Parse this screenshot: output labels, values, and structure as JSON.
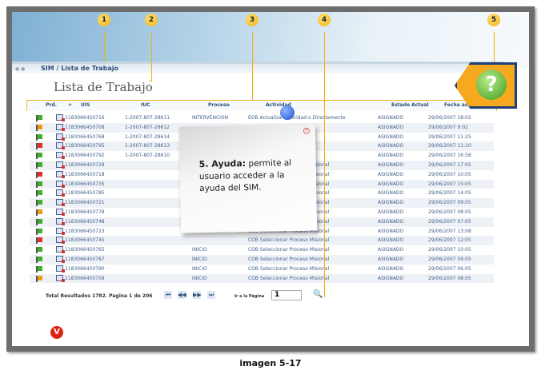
{
  "breadcrumb": "SIM / Lista de Trabajo",
  "page_title": "Lista de Trabajo",
  "columns": [
    "Prd.",
    "+",
    "UIS",
    "IUC",
    "Proceso",
    "Actividad",
    "Estado Actual",
    "Fecha asignación"
  ],
  "rows": [
    {
      "flag": "#3fae2a",
      "uis": "1183066450716",
      "iuc": "1-2007-807-28611",
      "proceso": "INTERVENCION",
      "actividad": "EOB Actualiza Autoridad o Directamente",
      "estado": "ASIGNADO",
      "fecha": "29/06/2007 18:02"
    },
    {
      "flag": "#f29a1a",
      "uis": "1183066450708",
      "iuc": "1-2007-807-28612",
      "proceso": "",
      "actividad": "",
      "estado": "ASIGNADO",
      "fecha": "29/06/2007 9:02"
    },
    {
      "flag": "#3fae2a",
      "uis": "1183066450768",
      "iuc": "1-2007-807-28614",
      "proceso": "",
      "actividad": "",
      "estado": "ASIGNADO",
      "fecha": "29/06/2007 11:25"
    },
    {
      "flag": "#e0302a",
      "uis": "1183066450795",
      "iuc": "1-2007-807-28613",
      "proceso": "",
      "actividad": "",
      "estado": "ASIGNADO",
      "fecha": "29/06/2007 11:10"
    },
    {
      "flag": "#3fae2a",
      "uis": "1183066450792",
      "iuc": "1-2007-807-28610",
      "proceso": "",
      "actividad": "",
      "estado": "ASIGNADO",
      "fecha": "29/06/2007 16:58"
    },
    {
      "flag": "#3fae2a",
      "uis": "1183066450728",
      "iuc": "",
      "proceso": "",
      "actividad": "COB Seleccionar Proceso Misional",
      "estado": "ASIGNADO",
      "fecha": "29/06/2007 17:05"
    },
    {
      "flag": "#e0302a",
      "uis": "1183066450718",
      "iuc": "",
      "proceso": "",
      "actividad": "COB Seleccionar Proceso Misional",
      "estado": "ASIGNADO",
      "fecha": "29/06/2007 10:05"
    },
    {
      "flag": "#3fae2a",
      "uis": "1183066450735",
      "iuc": "",
      "proceso": "",
      "actividad": "COB Seleccionar Proceso Misional",
      "estado": "ASIGNADO",
      "fecha": "29/06/2007 15:05"
    },
    {
      "flag": "#3fae2a",
      "uis": "1183066450785",
      "iuc": "",
      "proceso": "",
      "actividad": "COB Seleccionar Proceso Misional",
      "estado": "ASIGNADO",
      "fecha": "29/06/2007 14:05"
    },
    {
      "flag": "#3fae2a",
      "uis": "1183066450721",
      "iuc": "",
      "proceso": "",
      "actividad": "COB Seleccionar Proceso Misional",
      "estado": "ASIGNADO",
      "fecha": "29/06/2007 09:05"
    },
    {
      "flag": "#f29a1a",
      "uis": "1183066450778",
      "iuc": "",
      "proceso": "",
      "actividad": "COB Seleccionar Proceso Misional",
      "estado": "ASIGNADO",
      "fecha": "29/06/2007 08:05"
    },
    {
      "flag": "#3fae2a",
      "uis": "1183066450748",
      "iuc": "",
      "proceso": "",
      "actividad": "COB Seleccionar Proceso Misional",
      "estado": "ASIGNADO",
      "fecha": "29/06/2007 07:05"
    },
    {
      "flag": "#3fae2a",
      "uis": "1183066450723",
      "iuc": "",
      "proceso": "",
      "actividad": "COB Seleccionar Proceso Misional",
      "estado": "ASIGNADO",
      "fecha": "29/06/2007 13:08"
    },
    {
      "flag": "#e0302a",
      "uis": "1183066450745",
      "iuc": "",
      "proceso": "",
      "actividad": "COB Seleccionar Proceso Misional",
      "estado": "ASIGNADO",
      "fecha": "29/06/2007 12:05"
    },
    {
      "flag": "#3fae2a",
      "uis": "1183066450765",
      "iuc": "",
      "proceso": "INICIO",
      "actividad": "COB Seleccionar Proceso Misional",
      "estado": "ASIGNADO",
      "fecha": "29/06/2007 10:05"
    },
    {
      "flag": "#3fae2a",
      "uis": "1183066450787",
      "iuc": "",
      "proceso": "INICIO",
      "actividad": "COB Seleccionar Proceso Misional",
      "estado": "ASIGNADO",
      "fecha": "29/06/2007 09:05"
    },
    {
      "flag": "#3fae2a",
      "uis": "1183066450790",
      "iuc": "",
      "proceso": "INICIO",
      "actividad": "COB Seleccionar Proceso Misional",
      "estado": "ASIGNADO",
      "fecha": "29/06/2007 06:05"
    },
    {
      "flag": "#f29a1a",
      "uis": "1183066450709",
      "iuc": "",
      "proceso": "INICIO",
      "actividad": "COB Seleccionar Proceso Misional",
      "estado": "ASIGNADO",
      "fecha": "29/06/2007 08:05"
    }
  ],
  "pager": {
    "total": "Total Resultados 1782. Pagina 1 de 206",
    "first": "⏮",
    "prev": "◀◀",
    "next": "▶▶",
    "last": "⏭",
    "goto_label": "Ir a la Página",
    "page_value": "1",
    "search": "🔍"
  },
  "callouts": [
    "1",
    "2",
    "3",
    "4",
    "5"
  ],
  "help_icon": "?",
  "note": {
    "bold": "5. Ayuda:",
    "text": " permite al usuario acceder a la ayuda del SIM."
  },
  "logo": "V",
  "caption": "imagen 5-17"
}
